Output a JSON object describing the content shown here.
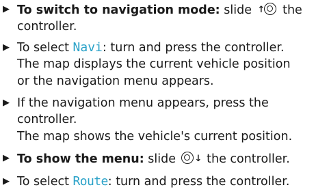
{
  "bullet_symbol": "▶",
  "controller_icons": [
    "slide-up-controller-icon",
    "slide-down-controller-icon"
  ],
  "items": [
    {
      "lead": "To switch to navigation mode:",
      "before_icon": " slide ",
      "arrow": "↑",
      "after_icon": " the",
      "line2": "controller."
    },
    {
      "pre": "To select ",
      "menu_item": "Navi",
      "post": ": turn and press the controller.",
      "line2": "The map displays the current vehicle position",
      "line3": "or the navigation menu appears."
    },
    {
      "line1": "If the navigation menu appears, press the",
      "line2": "controller.",
      "line3": "The map shows the vehicle's current position."
    },
    {
      "lead": "To show the menu:",
      "before_icon": " slide ",
      "arrow": "↓",
      "after_icon": " the controller."
    },
    {
      "pre": "To select ",
      "menu_item": "Route",
      "post": ": turn and press the controller."
    }
  ]
}
